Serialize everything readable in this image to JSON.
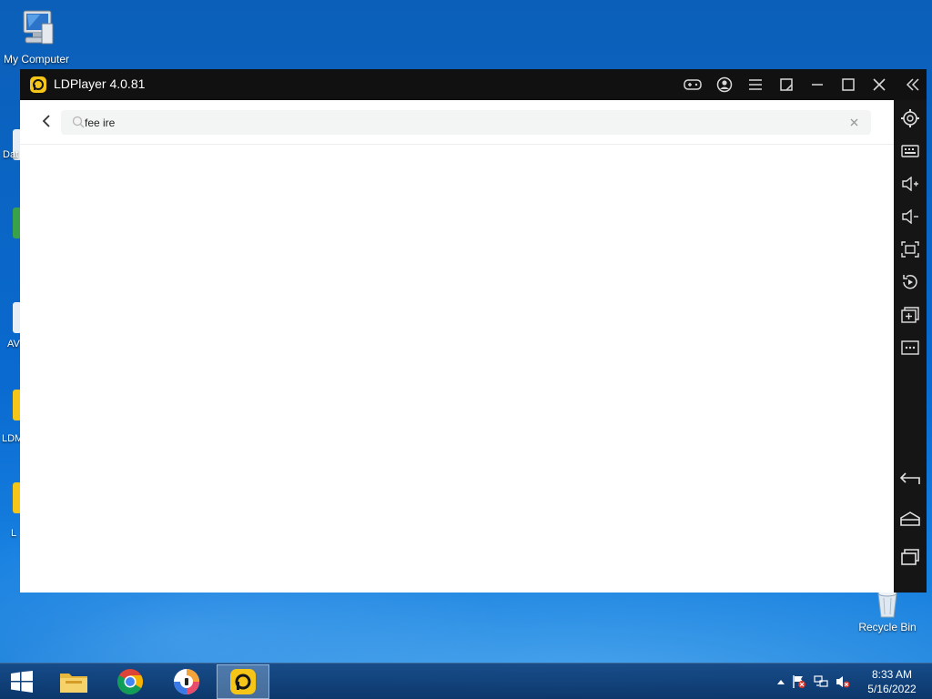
{
  "desktop": {
    "icons": [
      {
        "label": "My Computer"
      },
      {
        "label": "Recycle Bin"
      }
    ],
    "partial_labels": [
      "Dat",
      "AV",
      "LDM",
      "L"
    ]
  },
  "window": {
    "title": "LDPlayer 4.0.81",
    "search": {
      "value": "fee ire",
      "placeholder": ""
    },
    "titlebar_icons": [
      "gamepad-icon",
      "account-icon",
      "menu-icon",
      "resize-icon",
      "minimize-icon",
      "maximize-icon",
      "close-icon",
      "collapse-sidebar-icon"
    ],
    "sidebar_icons": [
      "settings-icon",
      "keyboard-icon",
      "volume-up-icon",
      "volume-down-icon",
      "screenshot-icon",
      "rotate-icon",
      "add-window-icon",
      "more-icon",
      "back-nav-icon",
      "home-nav-icon",
      "recents-nav-icon"
    ]
  },
  "taskbar": {
    "apps": [
      "file-explorer-icon",
      "chrome-icon",
      "vpn-app-icon",
      "ldplayer-icon"
    ],
    "clock": {
      "time": "8:33 AM",
      "date": "5/16/2022"
    }
  },
  "colors": {
    "accent": "#f5c518",
    "window_bg": "#151515"
  }
}
